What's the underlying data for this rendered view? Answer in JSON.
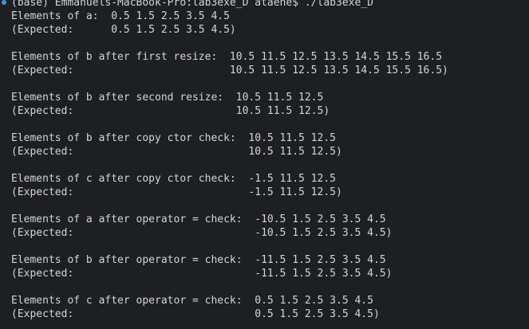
{
  "terminal": {
    "prompt": "(base) Emmanuels-MacBook-Pro:lab3exe_D ataene$ ./lab3exe_D",
    "lines": [
      "Elements of a:  0.5 1.5 2.5 3.5 4.5",
      "(Expected:      0.5 1.5 2.5 3.5 4.5)",
      "Elements of b after first resize:  10.5 11.5 12.5 13.5 14.5 15.5 16.5",
      "(Expected:                         10.5 11.5 12.5 13.5 14.5 15.5 16.5)",
      "Elements of b after second resize:  10.5 11.5 12.5",
      "(Expected:                          10.5 11.5 12.5)",
      "Elements of b after copy ctor check:  10.5 11.5 12.5",
      "(Expected:                            10.5 11.5 12.5)",
      "Elements of c after copy ctor check:  -1.5 11.5 12.5",
      "(Expected:                            -1.5 11.5 12.5)",
      "Elements of a after operator = check:  -10.5 1.5 2.5 3.5 4.5",
      "(Expected:                             -10.5 1.5 2.5 3.5 4.5)",
      "Elements of b after operator = check:  -11.5 1.5 2.5 3.5 4.5",
      "(Expected:                             -11.5 1.5 2.5 3.5 4.5)",
      "Elements of c after operator = check:  0.5 1.5 2.5 3.5 4.5",
      "(Expected:                             0.5 1.5 2.5 3.5 4.5)"
    ]
  },
  "colors": {
    "background": "#1e1f22",
    "text": "#d4d4d4",
    "status_dot": "#4a90d9"
  }
}
